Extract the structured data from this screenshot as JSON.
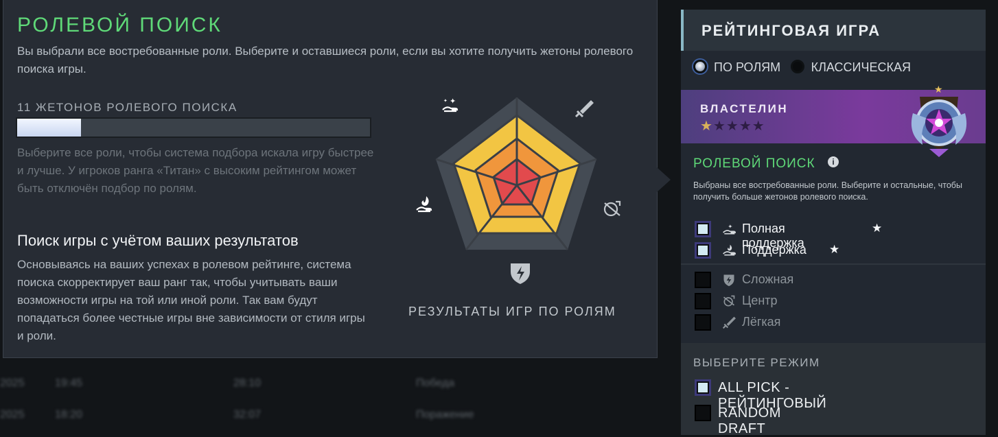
{
  "popup": {
    "title": "РОЛЕВОЙ ПОИСК",
    "subtitle": "Вы выбрали все востребованные роли. Выберите и оставшиеся роли, если вы хотите получить жетоны ролевого поиска игры.",
    "tokens_label": "11 ЖЕТОНОВ РОЛЕВОГО ПОИСКА",
    "token_fill_fraction": 0.18,
    "hint": "Выберите все роли, чтобы система подбора искала игру быстрее и лучше. У игроков ранга «Титан» с высоким рейтингом может быть отключён подбор по ролям.",
    "heading": "Поиск игры с учётом ваших результатов",
    "description": "Основываясь на ваших успехах в ролевом рейтинге, система поиска скорректирует ваш ранг так, чтобы учитывать ваши возможности игры на той или иной роли. Так вам будут попадаться более честные игры вне зависимости от стиля игры и роли.",
    "chart_label": "РЕЗУЛЬТАТЫ ИГР ПО РОЛЯМ",
    "radar_icons": [
      "hard-support-icon",
      "sword-icon",
      "bow-icon",
      "shield-icon",
      "support-icon"
    ]
  },
  "panel": {
    "title": "РЕЙТИНГОВАЯ ИГРА",
    "radio": [
      {
        "label": "ПО РОЛЯМ",
        "selected": true
      },
      {
        "label": "КЛАССИЧЕСКАЯ",
        "selected": false
      }
    ],
    "rank": {
      "name": "ВЛАСТЕЛИН",
      "stars_filled": 1,
      "stars_total": 5
    },
    "role_search": {
      "title": "РОЛЕВОЙ ПОИСК",
      "info": "i",
      "description": "Выбраны все востребованные роли. Выберите и остальные, чтобы получить больше жетонов ролевого поиска."
    },
    "roles": [
      {
        "label": "Полная поддержка",
        "checked": true,
        "star": "★",
        "icon": "hard-support-icon"
      },
      {
        "label": "Поддержка",
        "checked": true,
        "star": "★",
        "icon": "support-icon"
      },
      {
        "label": "Сложная",
        "checked": false,
        "icon": "shield-icon"
      },
      {
        "label": "Центр",
        "checked": false,
        "icon": "bow-icon"
      },
      {
        "label": "Лёгкая",
        "checked": false,
        "icon": "sword-icon"
      }
    ],
    "mode_title": "ВЫБЕРИТЕ РЕЖИМ",
    "modes": [
      {
        "label": "ALL PICK - РЕЙТИНГОВЫЙ",
        "checked": true
      },
      {
        "label": "RANDOM DRAFT",
        "checked": false
      }
    ]
  },
  "colors": {
    "accent_green": "#5fd978",
    "rank_purple": "#7a3a9c",
    "radar_yellow": "#f2c543",
    "radar_red": "#e24a4d"
  }
}
